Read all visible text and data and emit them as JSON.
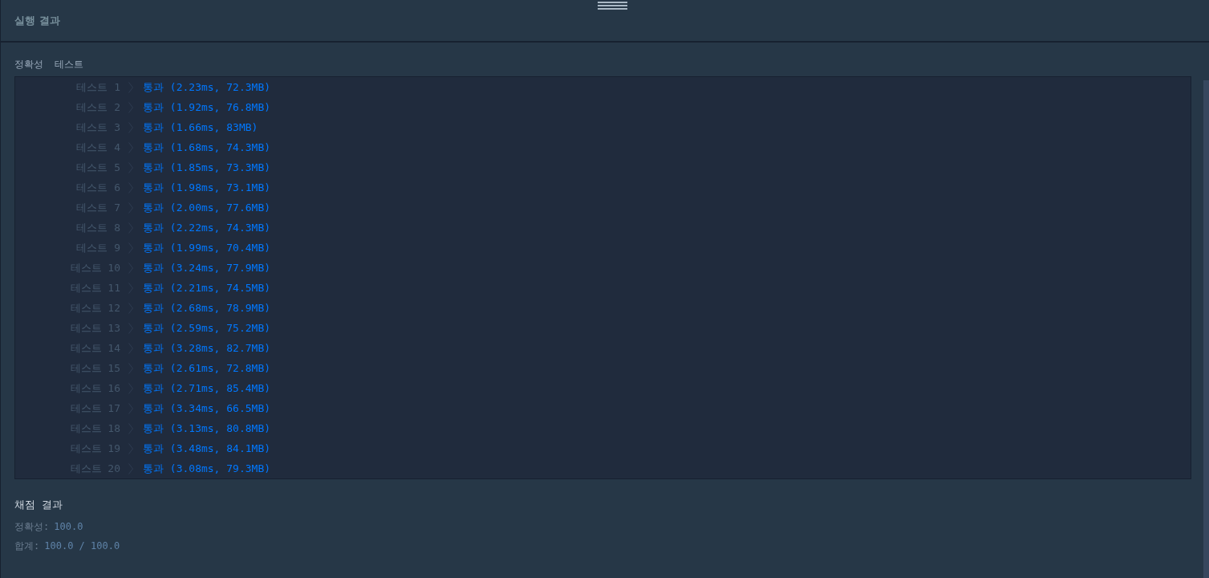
{
  "panel": {
    "title": "실행 결과"
  },
  "section_label": "정확성  테스트",
  "tests": [
    {
      "label": "테스트 1",
      "result": "통과 (2.23ms, 72.3MB)"
    },
    {
      "label": "테스트 2",
      "result": "통과 (1.92ms, 76.8MB)"
    },
    {
      "label": "테스트 3",
      "result": "통과 (1.66ms, 83MB)"
    },
    {
      "label": "테스트 4",
      "result": "통과 (1.68ms, 74.3MB)"
    },
    {
      "label": "테스트 5",
      "result": "통과 (1.85ms, 73.3MB)"
    },
    {
      "label": "테스트 6",
      "result": "통과 (1.98ms, 73.1MB)"
    },
    {
      "label": "테스트 7",
      "result": "통과 (2.00ms, 77.6MB)"
    },
    {
      "label": "테스트 8",
      "result": "통과 (2.22ms, 74.3MB)"
    },
    {
      "label": "테스트 9",
      "result": "통과 (1.99ms, 70.4MB)"
    },
    {
      "label": "테스트 10",
      "result": "통과 (3.24ms, 77.9MB)"
    },
    {
      "label": "테스트 11",
      "result": "통과 (2.21ms, 74.5MB)"
    },
    {
      "label": "테스트 12",
      "result": "통과 (2.68ms, 78.9MB)"
    },
    {
      "label": "테스트 13",
      "result": "통과 (2.59ms, 75.2MB)"
    },
    {
      "label": "테스트 14",
      "result": "통과 (3.28ms, 82.7MB)"
    },
    {
      "label": "테스트 15",
      "result": "통과 (2.61ms, 72.8MB)"
    },
    {
      "label": "테스트 16",
      "result": "통과 (2.71ms, 85.4MB)"
    },
    {
      "label": "테스트 17",
      "result": "통과 (3.34ms, 66.5MB)"
    },
    {
      "label": "테스트 18",
      "result": "통과 (3.13ms, 80.8MB)"
    },
    {
      "label": "테스트 19",
      "result": "통과 (3.48ms, 84.1MB)"
    },
    {
      "label": "테스트 20",
      "result": "통과 (3.08ms, 79.3MB)"
    }
  ],
  "summary": {
    "title": "채점 결과",
    "lines": [
      {
        "label": "정확성:",
        "value": "100.0"
      },
      {
        "label": "합계:",
        "value": "100.0 / 100.0"
      }
    ]
  }
}
